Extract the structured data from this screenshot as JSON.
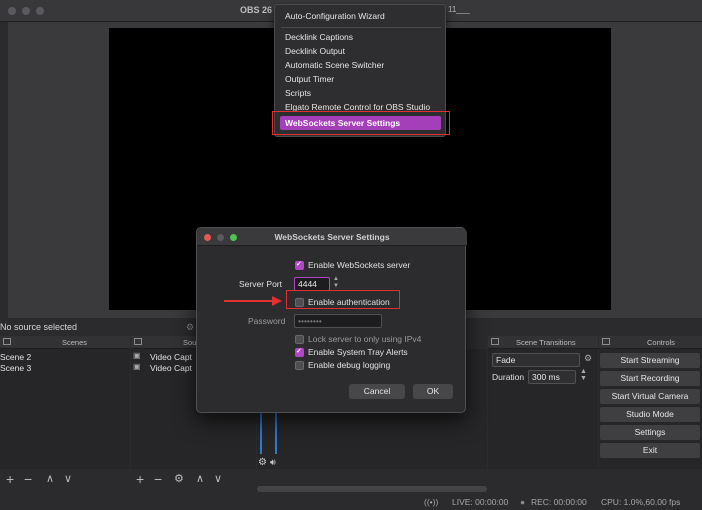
{
  "window": {
    "title": "OBS 26",
    "title_tail": "11___"
  },
  "tools_menu": {
    "items": [
      "Auto-Configuration Wizard",
      "Decklink Captions",
      "Decklink Output",
      "Automatic Scene Switcher",
      "Output Timer",
      "Scripts",
      "Elgato Remote Control for OBS Studio",
      "WebSockets Server Settings"
    ],
    "highlighted": "WebSockets Server Settings"
  },
  "status": {
    "no_source": "No source selected"
  },
  "scenes": {
    "header": "Scenes",
    "items": [
      "Scene 2",
      "Scene 3"
    ]
  },
  "sources": {
    "header": "Sou",
    "items": [
      "Video Capt",
      "Video Capt"
    ]
  },
  "transitions": {
    "header": "Scene Transitions",
    "selected": "Fade",
    "duration_label": "Duration",
    "duration_value": "300 ms"
  },
  "controls": {
    "header": "Controls",
    "buttons": [
      "Start Streaming",
      "Start Recording",
      "Start Virtual Camera",
      "Studio Mode",
      "Settings",
      "Exit"
    ]
  },
  "footer": {
    "live": "LIVE: 00:00:00",
    "rec": "REC: 00:00:00",
    "cpu": "CPU: 1.0%,60.00 fps"
  },
  "dialog": {
    "title": "WebSockets Server Settings",
    "enable_server": "Enable WebSockets server",
    "server_port_label": "Server Port",
    "server_port_value": "4444",
    "enable_auth": "Enable authentication",
    "password_label": "Password",
    "password_value": "••••••••",
    "lock_ipv4": "Lock server to only using IPv4",
    "tray_alerts": "Enable System Tray Alerts",
    "debug_logging": "Enable debug logging",
    "cancel": "Cancel",
    "ok": "OK"
  },
  "colors": {
    "accent": "#b345c7",
    "annotation": "#e03030"
  }
}
